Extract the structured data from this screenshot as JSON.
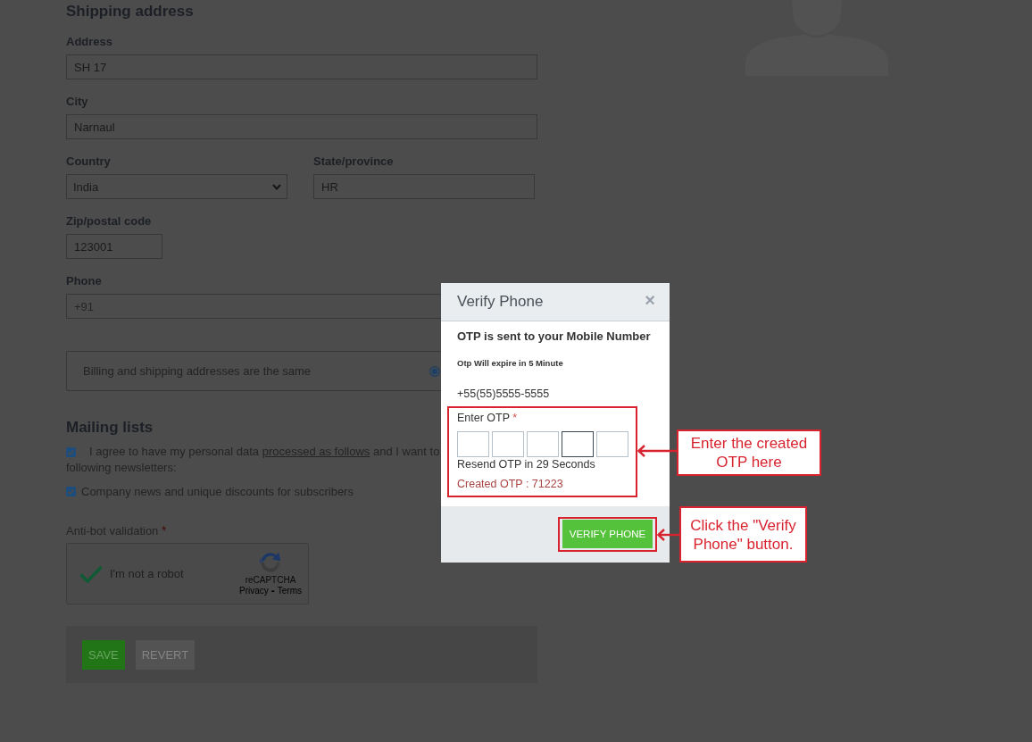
{
  "shipping_address": {
    "title": "Shipping address",
    "address": {
      "label": "Address",
      "value": "SH 17"
    },
    "city": {
      "label": "City",
      "value": "Narnaul"
    },
    "country": {
      "label": "Country",
      "value": "India"
    },
    "state_province": {
      "label": "State/province",
      "value": "HR"
    },
    "zip": {
      "label": "Zip/postal code",
      "value": "123001"
    },
    "phone": {
      "label": "Phone",
      "placeholder": "+91"
    }
  },
  "billing_same": {
    "label": "Billing and shipping addresses are the same",
    "selected": true
  },
  "mailing_lists": {
    "title": "Mailing lists",
    "consent": {
      "checked": true,
      "text_before": "I agree to have my personal data",
      "link": "processed as follows",
      "text_after": "and I want to",
      "continuation": "following newsletters:"
    },
    "newsletters": [
      {
        "label": "Company news and unique discounts for subscribers",
        "checked": true
      }
    ]
  },
  "anti_bot": {
    "label": "Anti-bot validation",
    "required_mark": "*",
    "captcha": {
      "checked": true,
      "label": "I'm not a robot",
      "brand": "reCAPTCHA",
      "privacy": "Privacy",
      "separator": "-",
      "terms": "Terms"
    }
  },
  "actions": [
    {
      "label": "SAVE",
      "kind": "primary"
    },
    {
      "label": "REVERT",
      "kind": "secondary"
    }
  ],
  "modal": {
    "title": "Verify Phone",
    "close": "×",
    "heading": "OTP is sent to your Mobile Number",
    "expiry": "Otp Will expire in 5 Minute",
    "phone": "+55(55)5555-5555",
    "otp_label": "Enter OTP",
    "otp_required_mark": "*",
    "otp_boxes": [
      {
        "focused": false
      },
      {
        "focused": false
      },
      {
        "focused": false
      },
      {
        "focused": true
      },
      {
        "focused": false
      }
    ],
    "resend": "Resend OTP in 29 Seconds",
    "created_otp": "Created OTP : 71223",
    "button": "VERIFY PHONE"
  },
  "annotations": [
    {
      "kind": "otp",
      "text": "Enter the created OTP here"
    },
    {
      "kind": "button",
      "text": "Click the \"Verify Phone\" button."
    }
  ]
}
